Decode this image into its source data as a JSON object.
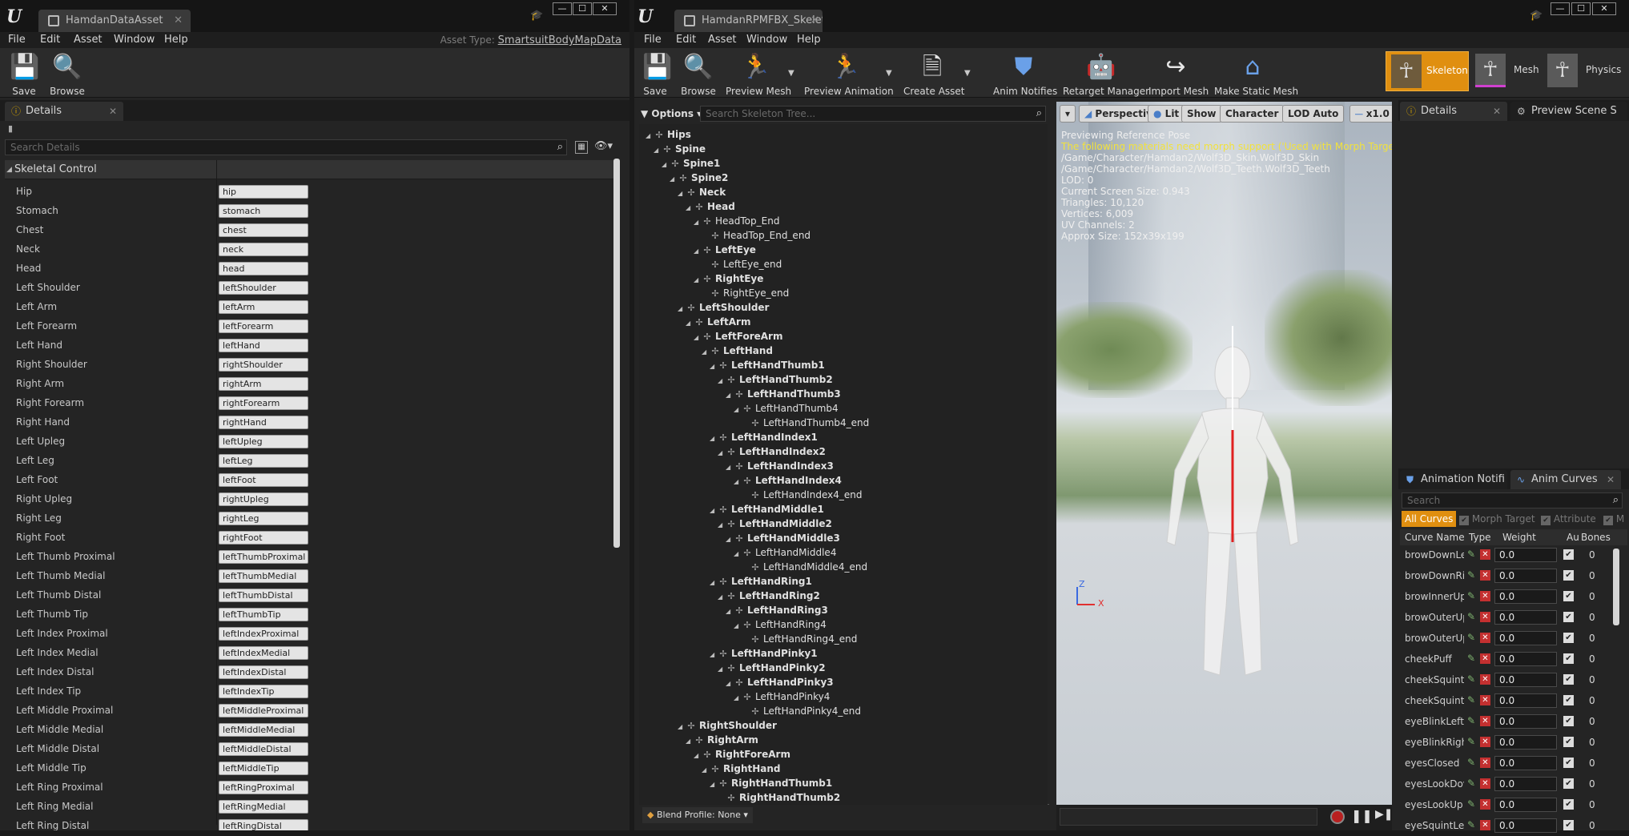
{
  "left_window": {
    "tab_title": "HamdanDataAsset",
    "menu": [
      "File",
      "Edit",
      "Asset",
      "Window",
      "Help"
    ],
    "asset_type_label": "Asset Type:",
    "asset_type_value": "SmartsuitBodyMapData",
    "toolbar": {
      "save": "Save",
      "browse": "Browse"
    },
    "details_tab": "Details",
    "search_placeholder": "Search Details",
    "category": "Skeletal Control",
    "properties": [
      {
        "label": "Hip",
        "value": "hip"
      },
      {
        "label": "Stomach",
        "value": "stomach"
      },
      {
        "label": "Chest",
        "value": "chest"
      },
      {
        "label": "Neck",
        "value": "neck"
      },
      {
        "label": "Head",
        "value": "head"
      },
      {
        "label": "Left Shoulder",
        "value": "leftShoulder"
      },
      {
        "label": "Left Arm",
        "value": "leftArm"
      },
      {
        "label": "Left Forearm",
        "value": "leftForearm"
      },
      {
        "label": "Left Hand",
        "value": "leftHand"
      },
      {
        "label": "Right Shoulder",
        "value": "rightShoulder"
      },
      {
        "label": "Right Arm",
        "value": "rightArm"
      },
      {
        "label": "Right Forearm",
        "value": "rightForearm"
      },
      {
        "label": "Right Hand",
        "value": "rightHand"
      },
      {
        "label": "Left Upleg",
        "value": "leftUpleg"
      },
      {
        "label": "Left Leg",
        "value": "leftLeg"
      },
      {
        "label": "Left Foot",
        "value": "leftFoot"
      },
      {
        "label": "Right Upleg",
        "value": "rightUpleg"
      },
      {
        "label": "Right Leg",
        "value": "rightLeg"
      },
      {
        "label": "Right Foot",
        "value": "rightFoot"
      },
      {
        "label": "Left Thumb Proximal",
        "value": "leftThumbProximal"
      },
      {
        "label": "Left Thumb Medial",
        "value": "leftThumbMedial"
      },
      {
        "label": "Left Thumb Distal",
        "value": "leftThumbDistal"
      },
      {
        "label": "Left Thumb Tip",
        "value": "leftThumbTip"
      },
      {
        "label": "Left Index Proximal",
        "value": "leftIndexProximal"
      },
      {
        "label": "Left Index Medial",
        "value": "leftIndexMedial"
      },
      {
        "label": "Left Index Distal",
        "value": "leftIndexDistal"
      },
      {
        "label": "Left Index Tip",
        "value": "leftIndexTip"
      },
      {
        "label": "Left Middle Proximal",
        "value": "leftMiddleProximal"
      },
      {
        "label": "Left Middle Medial",
        "value": "leftMiddleMedial"
      },
      {
        "label": "Left Middle Distal",
        "value": "leftMiddleDistal"
      },
      {
        "label": "Left Middle Tip",
        "value": "leftMiddleTip"
      },
      {
        "label": "Left Ring Proximal",
        "value": "leftRingProximal"
      },
      {
        "label": "Left Ring Medial",
        "value": "leftRingMedial"
      },
      {
        "label": "Left Ring Distal",
        "value": "leftRingDistal"
      }
    ]
  },
  "right_window": {
    "tab_title": "HamdanRPMFBX_Skeleto",
    "menu": [
      "File",
      "Edit",
      "Asset",
      "Window",
      "Help"
    ],
    "toolbar": [
      "Save",
      "Browse",
      "Preview Mesh",
      "Preview Animation",
      "Create Asset",
      "Anim Notifies",
      "Retarget Manager",
      "Import Mesh",
      "Make Static Mesh"
    ],
    "modes": [
      "Skeleton",
      "Mesh",
      "Physics"
    ],
    "options_label": "Options",
    "tree_search_placeholder": "Search Skeleton Tree...",
    "tree": [
      {
        "name": "Hips",
        "depth": 0,
        "bold": true
      },
      {
        "name": "Spine",
        "depth": 1,
        "bold": true
      },
      {
        "name": "Spine1",
        "depth": 2,
        "bold": true
      },
      {
        "name": "Spine2",
        "depth": 3,
        "bold": true
      },
      {
        "name": "Neck",
        "depth": 4,
        "bold": true
      },
      {
        "name": "Head",
        "depth": 5,
        "bold": true
      },
      {
        "name": "HeadTop_End",
        "depth": 6,
        "bold": false
      },
      {
        "name": "HeadTop_End_end",
        "depth": 7,
        "bold": false
      },
      {
        "name": "LeftEye",
        "depth": 6,
        "bold": true
      },
      {
        "name": "LeftEye_end",
        "depth": 7,
        "bold": false
      },
      {
        "name": "RightEye",
        "depth": 6,
        "bold": true
      },
      {
        "name": "RightEye_end",
        "depth": 7,
        "bold": false
      },
      {
        "name": "LeftShoulder",
        "depth": 4,
        "bold": true
      },
      {
        "name": "LeftArm",
        "depth": 5,
        "bold": true
      },
      {
        "name": "LeftForeArm",
        "depth": 6,
        "bold": true
      },
      {
        "name": "LeftHand",
        "depth": 7,
        "bold": true
      },
      {
        "name": "LeftHandThumb1",
        "depth": 8,
        "bold": true
      },
      {
        "name": "LeftHandThumb2",
        "depth": 9,
        "bold": true
      },
      {
        "name": "LeftHandThumb3",
        "depth": 10,
        "bold": true
      },
      {
        "name": "LeftHandThumb4",
        "depth": 11,
        "bold": false
      },
      {
        "name": "LeftHandThumb4_end",
        "depth": 12,
        "bold": false
      },
      {
        "name": "LeftHandIndex1",
        "depth": 8,
        "bold": true
      },
      {
        "name": "LeftHandIndex2",
        "depth": 9,
        "bold": true
      },
      {
        "name": "LeftHandIndex3",
        "depth": 10,
        "bold": true
      },
      {
        "name": "LeftHandIndex4",
        "depth": 11,
        "bold": true
      },
      {
        "name": "LeftHandIndex4_end",
        "depth": 12,
        "bold": false
      },
      {
        "name": "LeftHandMiddle1",
        "depth": 8,
        "bold": true
      },
      {
        "name": "LeftHandMiddle2",
        "depth": 9,
        "bold": true
      },
      {
        "name": "LeftHandMiddle3",
        "depth": 10,
        "bold": true
      },
      {
        "name": "LeftHandMiddle4",
        "depth": 11,
        "bold": false
      },
      {
        "name": "LeftHandMiddle4_end",
        "depth": 12,
        "bold": false
      },
      {
        "name": "LeftHandRing1",
        "depth": 8,
        "bold": true
      },
      {
        "name": "LeftHandRing2",
        "depth": 9,
        "bold": true
      },
      {
        "name": "LeftHandRing3",
        "depth": 10,
        "bold": true
      },
      {
        "name": "LeftHandRing4",
        "depth": 11,
        "bold": false
      },
      {
        "name": "LeftHandRing4_end",
        "depth": 12,
        "bold": false
      },
      {
        "name": "LeftHandPinky1",
        "depth": 8,
        "bold": true
      },
      {
        "name": "LeftHandPinky2",
        "depth": 9,
        "bold": true
      },
      {
        "name": "LeftHandPinky3",
        "depth": 10,
        "bold": true
      },
      {
        "name": "LeftHandPinky4",
        "depth": 11,
        "bold": false
      },
      {
        "name": "LeftHandPinky4_end",
        "depth": 12,
        "bold": false
      },
      {
        "name": "RightShoulder",
        "depth": 4,
        "bold": true
      },
      {
        "name": "RightArm",
        "depth": 5,
        "bold": true
      },
      {
        "name": "RightForeArm",
        "depth": 6,
        "bold": true
      },
      {
        "name": "RightHand",
        "depth": 7,
        "bold": true
      },
      {
        "name": "RightHandThumb1",
        "depth": 8,
        "bold": true
      },
      {
        "name": "RightHandThumb2",
        "depth": 9,
        "bold": true
      }
    ],
    "blend_profile": "Blend Profile: None",
    "viewport": {
      "perspective": "Perspective",
      "lit": "Lit",
      "show": "Show",
      "character": "Character",
      "lod": "LOD Auto",
      "speed": "x1.0",
      "info_lines": [
        {
          "text": "Previewing Reference Pose",
          "warn": false
        },
        {
          "text": "The following materials need morph support ('Used with Morph Targets' in m",
          "warn": true
        },
        {
          "text": "/Game/Character/Hamdan2/Wolf3D_Skin.Wolf3D_Skin",
          "warn": false
        },
        {
          "text": "/Game/Character/Hamdan2/Wolf3D_Teeth.Wolf3D_Teeth",
          "warn": false
        },
        {
          "text": "LOD: 0",
          "warn": false
        },
        {
          "text": "Current Screen Size: 0.943",
          "warn": false
        },
        {
          "text": "Triangles: 10,120",
          "warn": false
        },
        {
          "text": "Vertices: 6,009",
          "warn": false
        },
        {
          "text": "UV Channels: 2",
          "warn": false
        },
        {
          "text": "Approx Size: 152x39x199",
          "warn": false
        }
      ],
      "axis_z": "Z",
      "axis_x": "X"
    },
    "details_tab": "Details",
    "preview_scene_tab": "Preview Scene S",
    "anim_notify_tab": "Animation Notifi",
    "anim_curves_tab": "Anim Curves",
    "curves_search_placeholder": "Search",
    "filters": {
      "all_curves": "All Curves",
      "morph_target": "Morph Target",
      "attribute": "Attribute",
      "more": "M"
    },
    "columns": {
      "name": "Curve Name",
      "type": "Type",
      "weight": "Weight",
      "auto": "Au",
      "bones": "Bones"
    },
    "curves": [
      {
        "name": "browDownLe",
        "weight": "0.0",
        "bones": "0"
      },
      {
        "name": "browDownRi",
        "weight": "0.0",
        "bones": "0"
      },
      {
        "name": "browInnerUp",
        "weight": "0.0",
        "bones": "0"
      },
      {
        "name": "browOuterUp",
        "weight": "0.0",
        "bones": "0"
      },
      {
        "name": "browOuterUp",
        "weight": "0.0",
        "bones": "0"
      },
      {
        "name": "cheekPuff",
        "weight": "0.0",
        "bones": "0"
      },
      {
        "name": "cheekSquintL",
        "weight": "0.0",
        "bones": "0"
      },
      {
        "name": "cheekSquintR",
        "weight": "0.0",
        "bones": "0"
      },
      {
        "name": "eyeBlinkLeft",
        "weight": "0.0",
        "bones": "0"
      },
      {
        "name": "eyeBlinkRigh",
        "weight": "0.0",
        "bones": "0"
      },
      {
        "name": "eyesClosed",
        "weight": "0.0",
        "bones": "0"
      },
      {
        "name": "eyesLookDov",
        "weight": "0.0",
        "bones": "0"
      },
      {
        "name": "eyesLookUp",
        "weight": "0.0",
        "bones": "0"
      },
      {
        "name": "eyeSquintLef",
        "weight": "0.0",
        "bones": "0"
      }
    ]
  }
}
